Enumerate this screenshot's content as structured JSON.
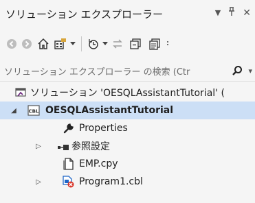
{
  "window": {
    "title": "ソリューション エクスプローラー",
    "controls": {
      "dropdown": "▼",
      "pin": "ᵖ",
      "close": "✕"
    }
  },
  "toolbar": {
    "items": [
      "back-icon",
      "forward-icon",
      "home-icon",
      "switch-views-icon",
      "dropdown-icon",
      "history-icon",
      "dropdown-icon",
      "sync-icon",
      "collapse-all-icon",
      "show-all-files-icon",
      "overflow-icon"
    ]
  },
  "search": {
    "placeholder": "ソリューション エクスプローラー の検索 (Ctr"
  },
  "tree": {
    "solution": "ソリューション 'OESQLAssistantTutorial' (",
    "project": "OESQLAssistantTutorial",
    "project_badge": "CBL",
    "items": [
      {
        "label": "Properties",
        "icon": "wrench-icon",
        "expandable": false
      },
      {
        "label": "参照設定",
        "icon": "references-icon",
        "expandable": true
      },
      {
        "label": "EMP.cpy",
        "icon": "file-icon",
        "expandable": false
      },
      {
        "label": "Program1.cbl",
        "icon": "cobol-file-icon",
        "expandable": true
      }
    ]
  },
  "colors": {
    "selection": "#ccdff6",
    "background": "#f5f5f5",
    "accent": "#1e66c8",
    "error": "#d9382c"
  }
}
